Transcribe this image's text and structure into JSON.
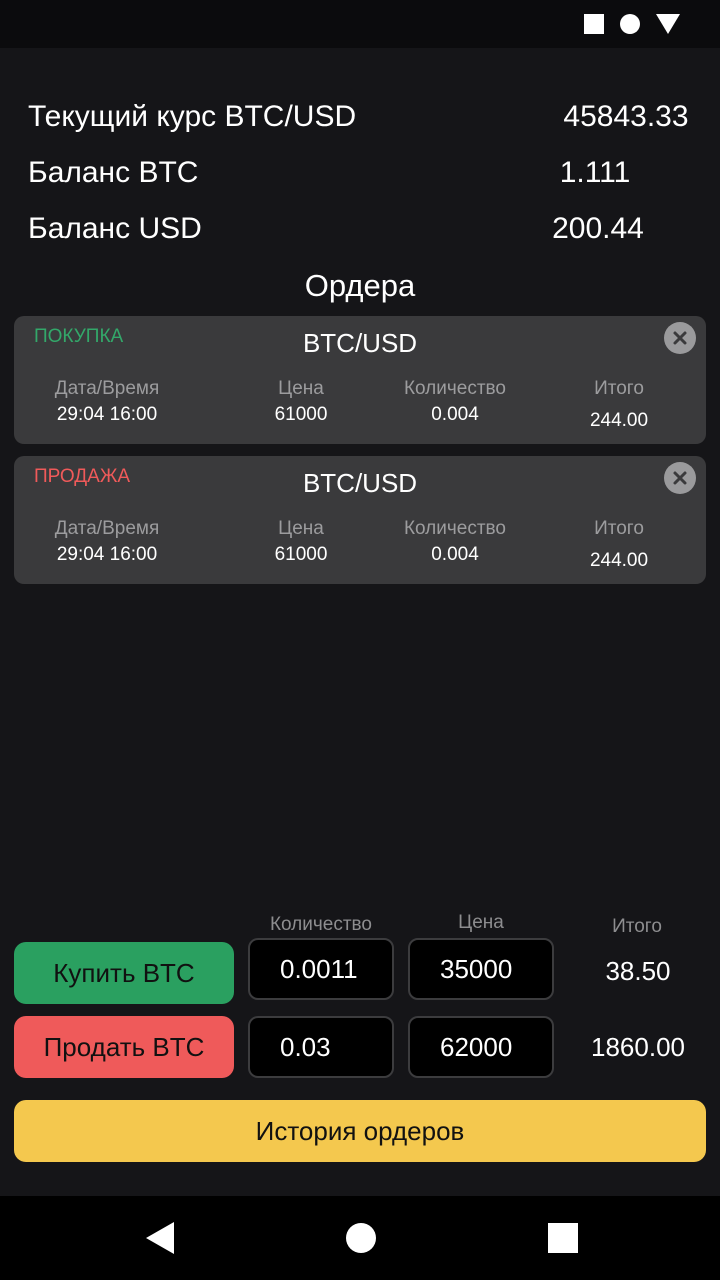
{
  "info": {
    "rate_label": "Текущий курс BTC/USD",
    "rate_value": "45843.33",
    "btc_label": "Баланс BTC",
    "btc_value": "1.111",
    "usd_label": "Баланс USD",
    "usd_value": "200.44"
  },
  "orders_title": "Ордера",
  "orders": [
    {
      "type": "ПОКУПКА",
      "pair": "BTC/USD",
      "datetime_label": "Дата/Время",
      "datetime": "29:04 16:00",
      "price_label": "Цена",
      "price": "61000",
      "qty_label": "Количество",
      "qty": "0.004",
      "total_label": "Итого",
      "total": "244.00"
    },
    {
      "type": "ПРОДАЖА",
      "pair": "BTC/USD",
      "datetime_label": "Дата/Время",
      "datetime": "29:04 16:00",
      "price_label": "Цена",
      "price": "61000",
      "qty_label": "Количество",
      "qty": "0.004",
      "total_label": "Итого",
      "total": "244.00"
    }
  ],
  "trade": {
    "qty_header": "Количество",
    "price_header": "Цена",
    "total_header": "Итого",
    "buy": {
      "label": "Купить BTC",
      "qty": "0.0011",
      "price": "35000",
      "total": "38.50"
    },
    "sell": {
      "label": "Продать BTC",
      "qty": "0.03",
      "price": "62000",
      "total": "1860.00"
    }
  },
  "history_button": "История ордеров",
  "colors": {
    "background": "#151518",
    "buy": "#2aa060",
    "sell": "#ef5a5a",
    "history": "#f4c84e",
    "card": "#3a3a3c"
  },
  "icons": {
    "status": [
      "square-icon",
      "circle-icon",
      "triangle-icon"
    ],
    "order_close": "close-icon",
    "nav": [
      "back-icon",
      "home-icon",
      "recents-icon"
    ]
  }
}
